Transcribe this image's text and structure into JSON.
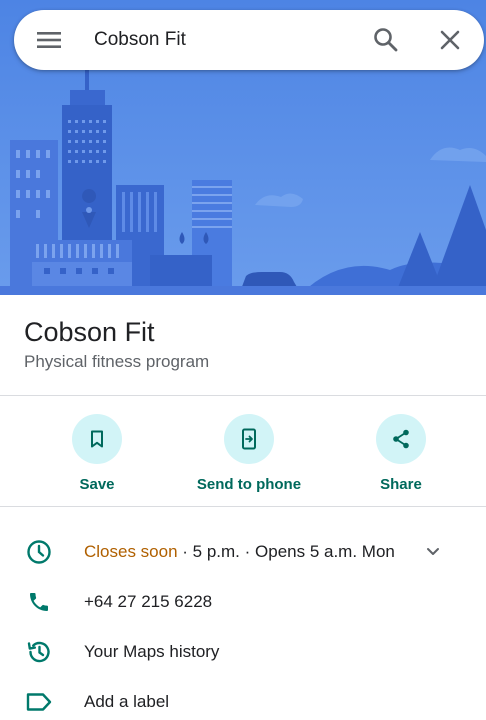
{
  "search": {
    "query": "Cobson Fit",
    "menu_icon": "menu-icon",
    "search_icon": "search-icon",
    "close_icon": "close-icon"
  },
  "hero": {
    "illustration": "city-skyline-illustration",
    "colors": {
      "sky": "#5a8fe6",
      "buildings": "#3f6fd6",
      "buildings_dark": "#3562c8"
    }
  },
  "place": {
    "name": "Cobson Fit",
    "category": "Physical fitness program"
  },
  "actions": [
    {
      "label": "Save",
      "icon": "bookmark-icon"
    },
    {
      "label": "Send to phone",
      "icon": "send-to-phone-icon"
    },
    {
      "label": "Share",
      "icon": "share-icon"
    }
  ],
  "info": {
    "hours": {
      "status": "Closes soon",
      "detail": " · 5 p.m. · Opens 5 a.m. Mon",
      "icon": "clock-icon",
      "expand_icon": "chevron-down-icon"
    },
    "phone": {
      "value": "+64 27 215 6228",
      "icon": "phone-icon"
    },
    "history": {
      "label": "Your Maps history",
      "icon": "history-icon"
    },
    "label": {
      "label": "Add a label",
      "icon": "label-icon"
    }
  },
  "colors": {
    "accent": "#00695c",
    "icon_teal": "#00796b",
    "action_circle": "#d2f4f7",
    "status_orange": "#b06000",
    "divider": "#dadce0"
  }
}
